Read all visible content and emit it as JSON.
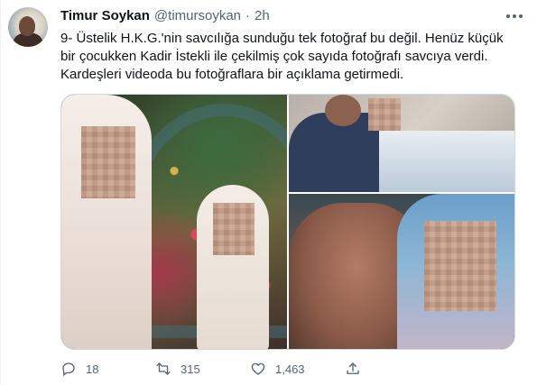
{
  "author": {
    "name": "Timur Soykan",
    "handle": "@timursoykan",
    "separator": "·",
    "time": "2h"
  },
  "tweet": {
    "line1": "9- Üstelik H.K.G.'nin savcılığa sunduğu tek fotoğraf bu değil. Henüz küçük",
    "line2": "bir çocukken Kadir İstekli ile çekilmiş çok sayıda fotoğrafı savcıya verdi.",
    "line3": "Kardeşleri videoda bu fotoğraflara bir açıklama getirmedi."
  },
  "actions": {
    "replies": "18",
    "retweets": "315",
    "likes": "1,463"
  },
  "icons": {
    "more": "more-dots-icon",
    "reply": "reply-icon",
    "retweet": "retweet-icon",
    "like": "heart-icon",
    "share": "share-icon"
  },
  "colors": {
    "text": "#0f1419",
    "secondary": "#536471",
    "border": "#cfd9de"
  }
}
